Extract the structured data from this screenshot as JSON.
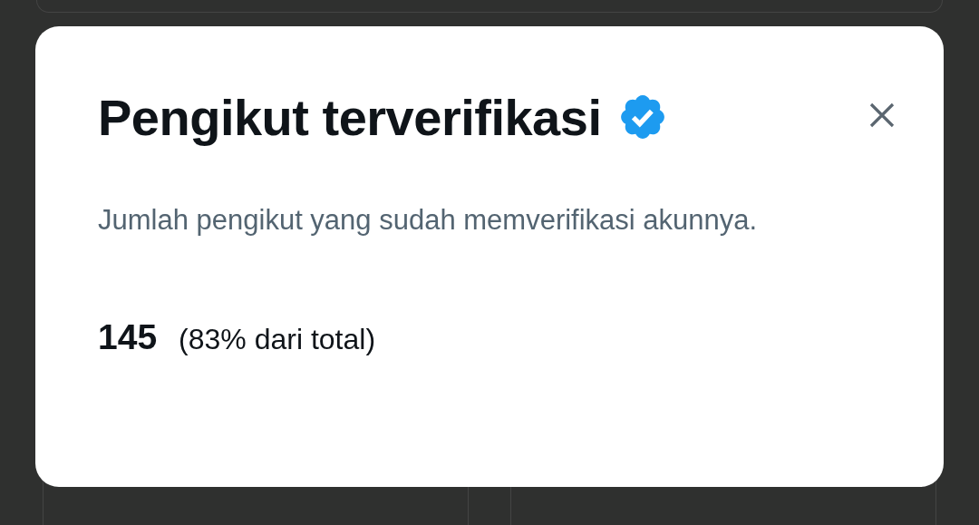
{
  "dialog": {
    "title": "Pengikut terverifikasi",
    "verified": true,
    "description": "Jumlah pengikut yang sudah memverifikasi akunnya.",
    "count": "145",
    "share": "(83% dari total)"
  }
}
